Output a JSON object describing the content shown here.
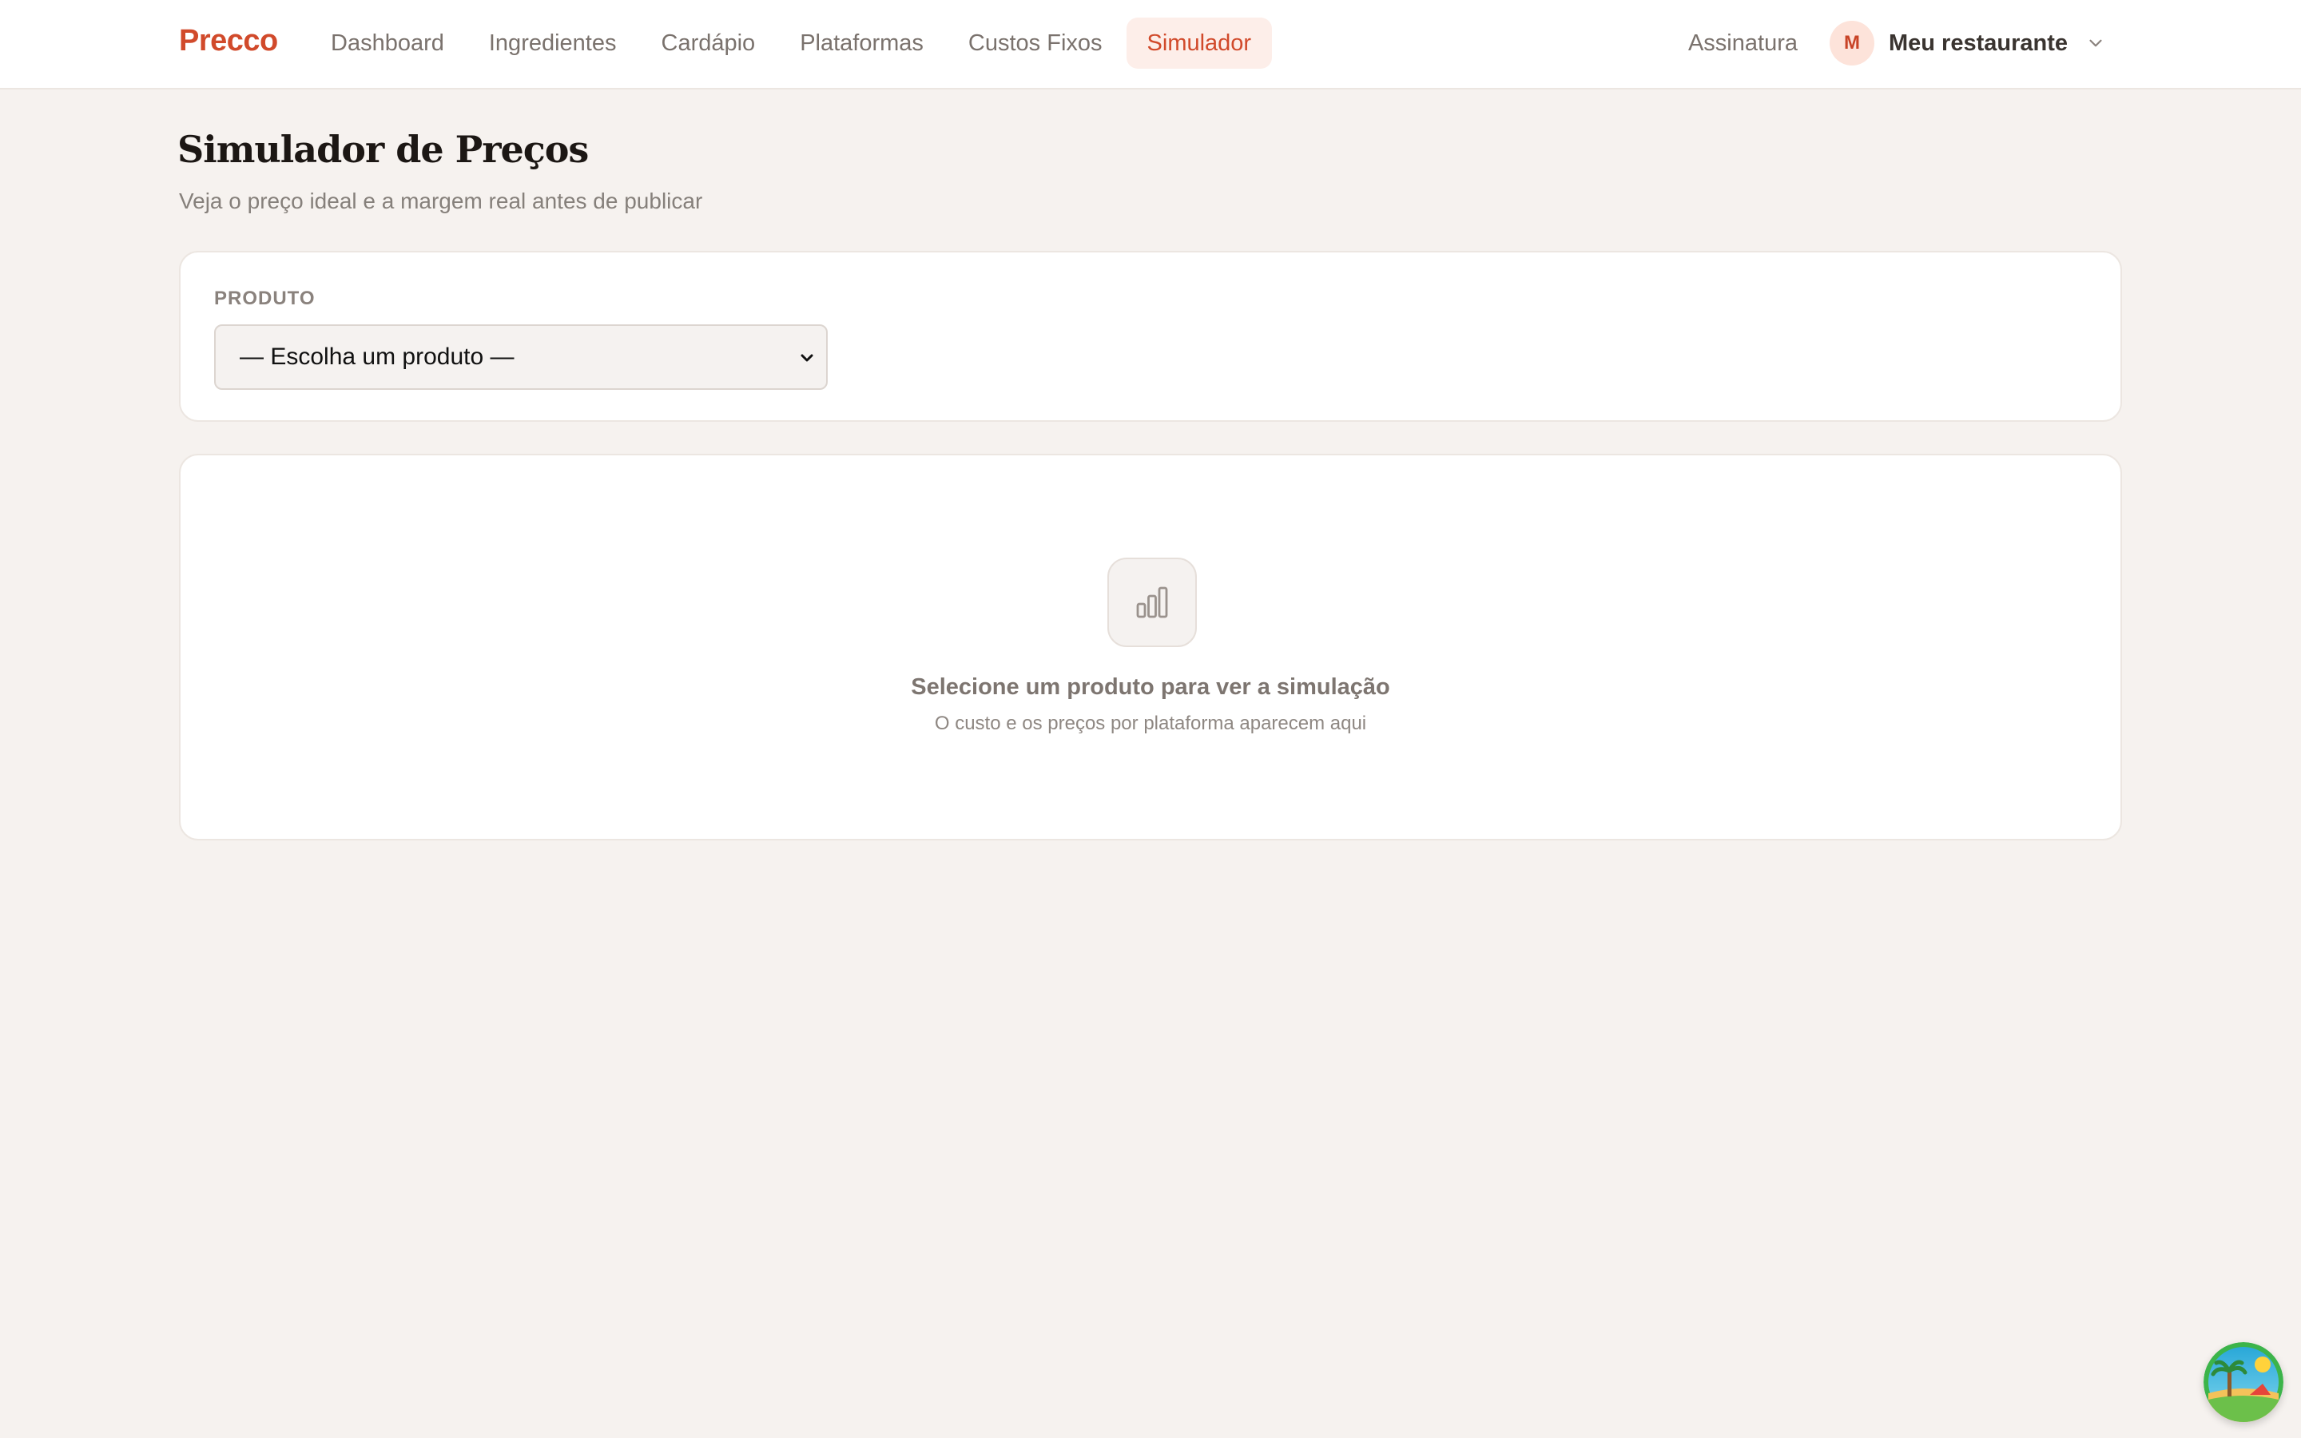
{
  "app": {
    "brand": "Precco"
  },
  "nav": {
    "items": [
      {
        "label": "Dashboard",
        "active": false
      },
      {
        "label": "Ingredientes",
        "active": false
      },
      {
        "label": "Cardápio",
        "active": false
      },
      {
        "label": "Plataformas",
        "active": false
      },
      {
        "label": "Custos Fixos",
        "active": false
      },
      {
        "label": "Simulador",
        "active": true
      }
    ],
    "subscription": "Assinatura",
    "account": {
      "initial": "M",
      "name": "Meu restaurante",
      "icon": "chevron-down-icon"
    }
  },
  "page": {
    "title": "Simulador de Preços",
    "subtitle": "Veja o preço ideal e a margem real antes de publicar"
  },
  "product_picker": {
    "label": "PRODUTO",
    "selected": "— Escolha um produto —"
  },
  "empty_state": {
    "icon": "bar-chart-icon",
    "title": "Selecione um produto para ver a simulação",
    "description": "O custo e os preços por plataforma aparecem aqui"
  },
  "colors": {
    "accent": "#d14a2b",
    "background": "#f6f2ef",
    "card": "#ffffff"
  }
}
